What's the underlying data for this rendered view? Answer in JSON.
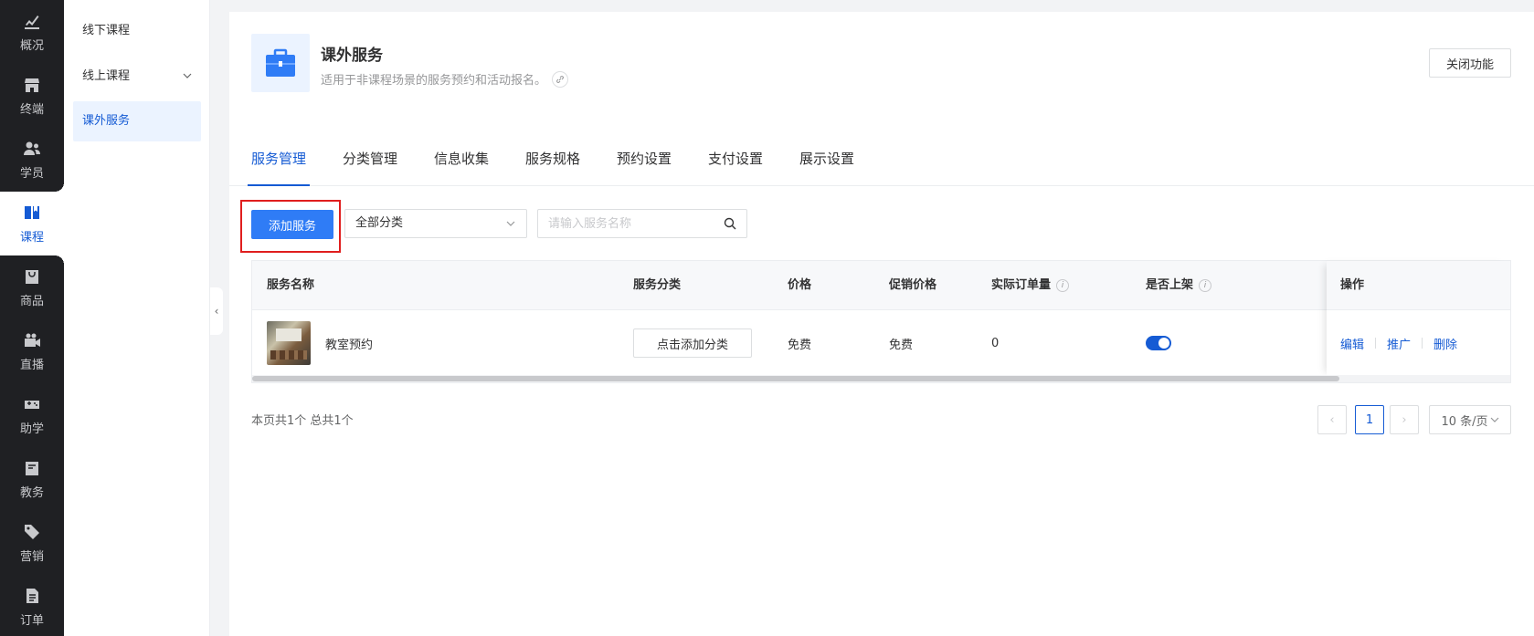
{
  "nav": {
    "items": [
      {
        "label": "概况",
        "icon": "chart-icon"
      },
      {
        "label": "终端",
        "icon": "store-icon"
      },
      {
        "label": "学员",
        "icon": "users-icon"
      },
      {
        "label": "课程",
        "icon": "book-icon"
      },
      {
        "label": "商品",
        "icon": "bag-icon"
      },
      {
        "label": "直播",
        "icon": "video-icon"
      },
      {
        "label": "助学",
        "icon": "gamepad-icon"
      },
      {
        "label": "教务",
        "icon": "calendar-icon"
      },
      {
        "label": "营销",
        "icon": "tag-icon"
      },
      {
        "label": "订单",
        "icon": "document-icon"
      }
    ],
    "active_index": 3
  },
  "subnav": {
    "items": [
      {
        "label": "线下课程"
      },
      {
        "label": "线上课程"
      },
      {
        "label": "课外服务"
      }
    ]
  },
  "header": {
    "title": "课外服务",
    "description": "适用于非课程场景的服务预约和活动报名。",
    "close_button": "关闭功能"
  },
  "tabs": [
    "服务管理",
    "分类管理",
    "信息收集",
    "服务规格",
    "预约设置",
    "支付设置",
    "展示设置"
  ],
  "toolbar": {
    "add_button": "添加服务",
    "category_select": "全部分类",
    "search_placeholder": "请输入服务名称"
  },
  "table": {
    "headers": {
      "name": "服务名称",
      "category": "服务分类",
      "price": "价格",
      "promo_price": "促销价格",
      "orders": "实际订单量",
      "listed": "是否上架",
      "actions": "操作"
    },
    "rows": [
      {
        "name": "教室预约",
        "category_button": "点击添加分类",
        "price": "免费",
        "promo_price": "免费",
        "orders": "0",
        "listed": true,
        "actions": {
          "edit": "编辑",
          "promote": "推广",
          "delete": "删除"
        }
      }
    ]
  },
  "pagination": {
    "summary": "本页共1个 总共1个",
    "current_page": "1",
    "page_size": "10 条/页"
  },
  "colors": {
    "brand": "#155bd4",
    "nav_bg": "#1f2023",
    "highlight_border": "#e01e1e"
  }
}
